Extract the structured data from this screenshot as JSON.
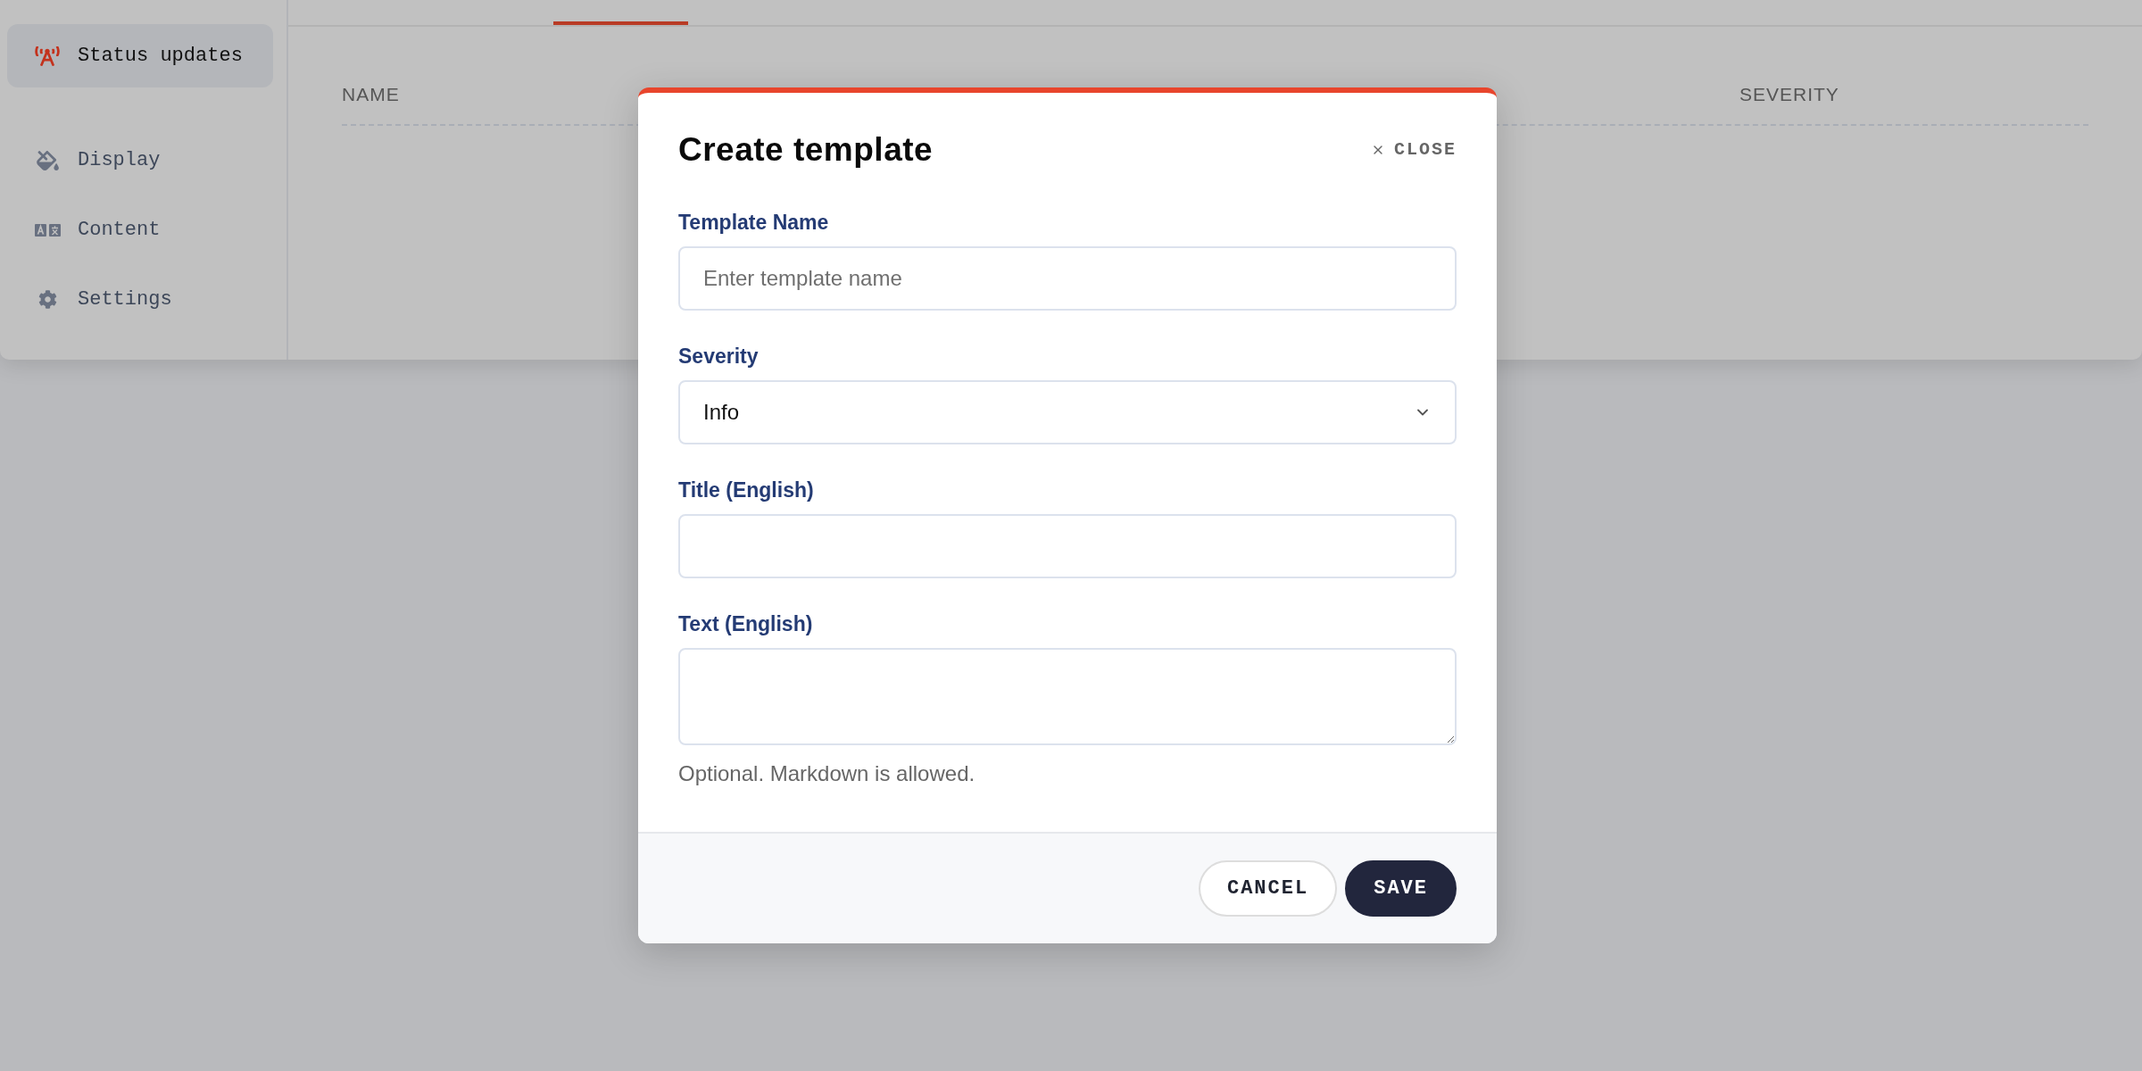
{
  "sidebar": {
    "items": [
      {
        "label": "Status updates",
        "selected": true
      },
      {
        "label": "Display",
        "selected": false
      },
      {
        "label": "Content",
        "selected": false
      },
      {
        "label": "Settings",
        "selected": false
      }
    ]
  },
  "table": {
    "columns": [
      "NAME",
      "SEVERITY"
    ]
  },
  "dialog": {
    "title": "Create template",
    "close": "CLOSE",
    "fields": [
      {
        "kind": "input",
        "label": "Template Name",
        "placeholder": "Enter template name"
      },
      {
        "kind": "select",
        "label": "Severity",
        "value": "Info"
      },
      {
        "kind": "input",
        "label": "Title (English)"
      },
      {
        "kind": "textarea",
        "label": "Text (English)",
        "hint": "Optional. Markdown is allowed."
      }
    ],
    "buttons": [
      {
        "kind": "secondary",
        "label": "CANCEL"
      },
      {
        "kind": "primary",
        "label": "SAVE"
      }
    ]
  }
}
